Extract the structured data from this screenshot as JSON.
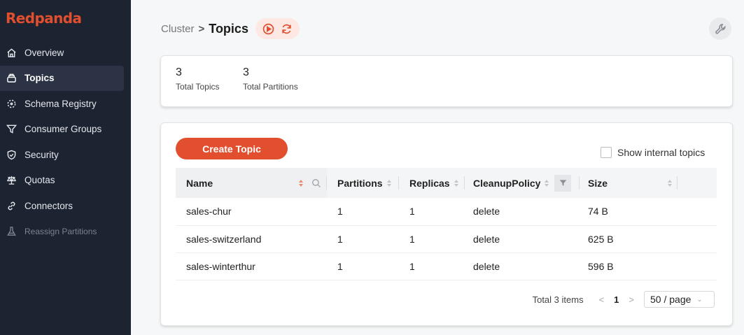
{
  "brand": "Redpanda",
  "colors": {
    "accent": "#e14f2f",
    "sidebar": "#1c2331"
  },
  "sidebar": {
    "items": [
      {
        "label": "Overview",
        "icon": "home-icon"
      },
      {
        "label": "Topics",
        "icon": "topics-icon",
        "active": true
      },
      {
        "label": "Schema Registry",
        "icon": "schema-icon"
      },
      {
        "label": "Consumer Groups",
        "icon": "funnel-icon"
      },
      {
        "label": "Security",
        "icon": "shield-icon"
      },
      {
        "label": "Quotas",
        "icon": "scale-icon"
      },
      {
        "label": "Connectors",
        "icon": "link-icon"
      },
      {
        "label": "Reassign Partitions",
        "icon": "flask-icon",
        "disabled": true
      }
    ]
  },
  "breadcrumb": {
    "parent": "Cluster",
    "separator": ">",
    "current": "Topics"
  },
  "stats": [
    {
      "value": "3",
      "label": "Total Topics"
    },
    {
      "value": "3",
      "label": "Total Partitions"
    }
  ],
  "topics": {
    "create_label": "Create Topic",
    "show_internal_label": "Show internal topics",
    "columns": [
      "Name",
      "Partitions",
      "Replicas",
      "CleanupPolicy",
      "Size"
    ],
    "rows": [
      {
        "name": "sales-chur",
        "partitions": "1",
        "replicas": "1",
        "cleanup": "delete",
        "size": "74 B"
      },
      {
        "name": "sales-switzerland",
        "partitions": "1",
        "replicas": "1",
        "cleanup": "delete",
        "size": "625 B"
      },
      {
        "name": "sales-winterthur",
        "partitions": "1",
        "replicas": "1",
        "cleanup": "delete",
        "size": "596 B"
      }
    ]
  },
  "pagination": {
    "total": "Total 3 items",
    "prev": "<",
    "page": "1",
    "next": ">",
    "page_size": "50 / page"
  }
}
